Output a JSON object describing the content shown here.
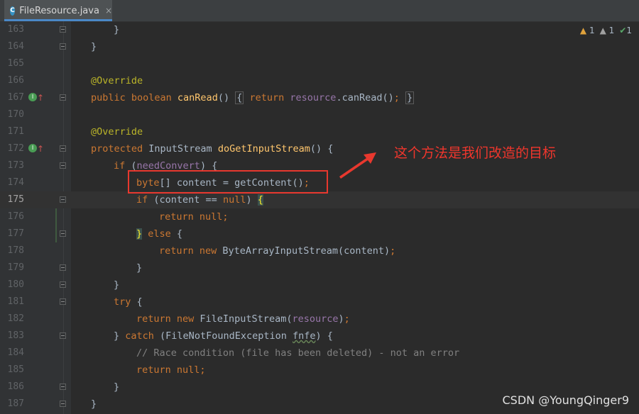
{
  "tab": {
    "icon": "C",
    "filename": "FileResource.java",
    "close": "×"
  },
  "inspections": [
    {
      "icon": "warning-icon",
      "glyph": "▲",
      "count": "1"
    },
    {
      "icon": "weak-warning-icon",
      "glyph": "▲",
      "count": "1"
    },
    {
      "icon": "typo-check-icon",
      "glyph": "✔",
      "count": "1"
    }
  ],
  "gutter_marks": {
    "impl_icon": "I",
    "arrow": "↑"
  },
  "lines": [
    {
      "num": "163",
      "code": "            }"
    },
    {
      "num": "164",
      "code": "        }"
    },
    {
      "num": "165",
      "code": ""
    },
    {
      "num": "166",
      "code": "        @Override"
    },
    {
      "num": "167",
      "code": "        public boolean canRead() { return resource.canRead(); }"
    },
    {
      "num": "170",
      "code": ""
    },
    {
      "num": "171",
      "code": "        @Override"
    },
    {
      "num": "172",
      "code": "        protected InputStream doGetInputStream() {"
    },
    {
      "num": "173",
      "code": "            if (needConvert) {"
    },
    {
      "num": "174",
      "code": "                byte[] content = getContent();"
    },
    {
      "num": "175",
      "code": "                if (content == null) {"
    },
    {
      "num": "176",
      "code": "                    return null;"
    },
    {
      "num": "177",
      "code": "                } else {"
    },
    {
      "num": "178",
      "code": "                    return new ByteArrayInputStream(content);"
    },
    {
      "num": "179",
      "code": "                }"
    },
    {
      "num": "180",
      "code": "            }"
    },
    {
      "num": "181",
      "code": "            try {"
    },
    {
      "num": "182",
      "code": "                return new FileInputStream(resource);"
    },
    {
      "num": "183",
      "code": "            } catch (FileNotFoundException fnfe) {"
    },
    {
      "num": "184",
      "code": "                // Race condition (file has been deleted) - not an error"
    },
    {
      "num": "185",
      "code": "                return null;"
    },
    {
      "num": "186",
      "code": "            }"
    },
    {
      "num": "187",
      "code": "        }"
    }
  ],
  "annotation_text": "这个方法是我们改造的目标",
  "watermark": "CSDN @YoungQinger9",
  "colors": {
    "background": "#2b2b2b",
    "keyword": "#cc7832",
    "annotation": "#bbb529",
    "method": "#ffc66d",
    "field": "#9876aa",
    "comment": "#808080",
    "highlight_box": "#e8382e"
  }
}
